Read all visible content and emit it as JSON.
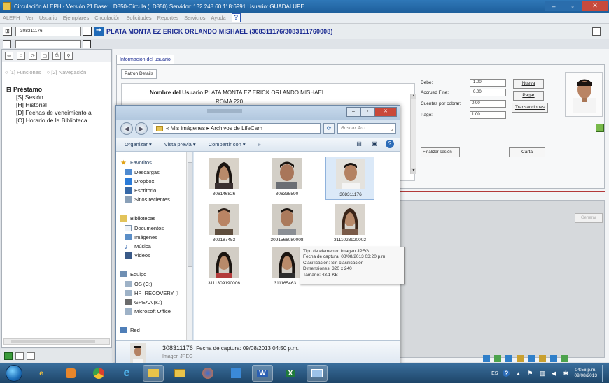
{
  "window": {
    "title": "Circulación ALEPH - Versión 21  Base: LD850-Circula (LD850)  Servidor: 132.248.60.118:6991  Usuario: GUADALUPE",
    "controls": [
      "–",
      "▫",
      "✕"
    ]
  },
  "menu": [
    "ALEPH",
    "Ver",
    "Usuario",
    "Ejemplares",
    "Circulación",
    "Solicitudes",
    "Reportes",
    "Servicios",
    "Ayuda"
  ],
  "menu_help": "?",
  "patron": {
    "id_value": "308311176",
    "title": "PLATA MONTA EZ ERICK ORLANDO MISHAEL (308311176/3083111760008)"
  },
  "left_panel": {
    "tabs": [
      "[1] Funciones",
      "[2] Navegación"
    ],
    "tree_root": "Préstamo",
    "tree_items": [
      "[S] Sesión",
      "[H] Historial",
      "[D] Fechas de vencimiento a",
      "[O] Horario de la Biblioteca"
    ]
  },
  "main": {
    "tab_info": "Información del usuario",
    "tab_patron": "Patron Details",
    "name_label": "Nombre del Usuario",
    "name_value": "PLATA MONTA EZ ERICK ORLANDO MISHAEL",
    "address": "ROMA 220",
    "fin_labels": [
      "Debe:",
      "Accrued Fine:",
      "Cuentas por cobrar:",
      "Pago:"
    ],
    "fin_values": [
      "-1.00",
      "-0.00",
      "0.00",
      "1.00"
    ],
    "fin_buttons": [
      "Nueva",
      "Pagar",
      "Transacciones"
    ],
    "finalizar": "Finalizar sesión",
    "carta": "Carta",
    "generar": "Generar"
  },
  "explorer": {
    "back": "◀",
    "forward": "▶",
    "path": "« Mis imágenes ▸ Archivos de LifeCam",
    "search_placeholder": "Buscar Arc...",
    "commands": [
      "Organizar ▾",
      "Vista previa ▾",
      "Compartir con ▾",
      "»"
    ],
    "nav": {
      "favorites_header": "Favoritos",
      "favorites": [
        "Descargas",
        "Dropbox",
        "Escritorio",
        "Sitios recientes"
      ],
      "libraries_header": "Bibliotecas",
      "libraries": [
        "Documentos",
        "Imágenes",
        "Música",
        "Videos"
      ],
      "computer_header": "Equipo",
      "computer": [
        "OS (C:)",
        "HP_RECOVERY (I",
        "GPEAA (K:)",
        "Microsoft Office"
      ],
      "network_header": "Red"
    },
    "thumbnails": [
      {
        "name": "306146826",
        "selected": false
      },
      {
        "name": "306335590",
        "selected": false
      },
      {
        "name": "308311176",
        "selected": true
      },
      {
        "name": "309187453",
        "selected": false
      },
      {
        "name": "3091566080008",
        "selected": false
      },
      {
        "name": "3111023920002",
        "selected": false
      },
      {
        "name": "3111309190006",
        "selected": false
      },
      {
        "name": "311165463...",
        "selected": false
      }
    ],
    "tooltip": [
      "Tipo de elemento: Imagen JPEG",
      "Fecha de captura: 08/08/2013 03:20 p.m.",
      "Clasificación: Sin clasificación",
      "Dimensiones: 320 x 240",
      "Tamaño: 43.1 KB"
    ],
    "details": {
      "name": "308311176",
      "date": "Fecha de captura: 09/08/2013 04:50 p.m.",
      "type": "Imagen JPEG"
    }
  },
  "taskbar": {
    "apps": [
      "IE",
      "Explorer",
      "Firefox",
      "Aleph",
      "Word",
      "Excel",
      "Explorer-window"
    ],
    "lang": "ES",
    "time": "04:56 p.m.",
    "date": "09/08/2013"
  }
}
